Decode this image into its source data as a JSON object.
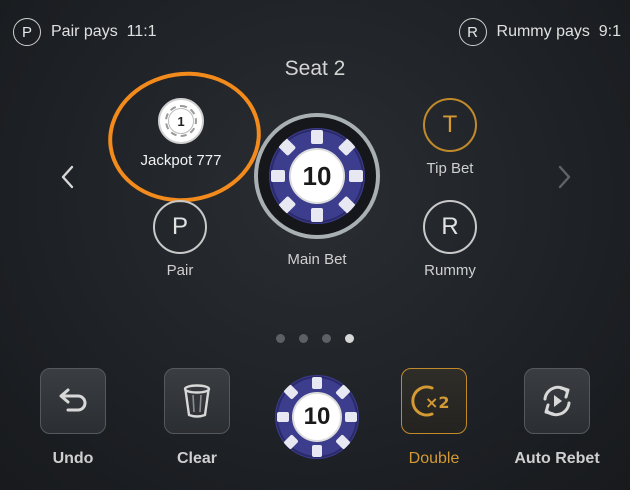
{
  "header": {
    "pair_badge": "P",
    "pair_pays": "Pair pays  11:1",
    "rummy_badge": "R",
    "rummy_pays": "Rummy pays  9:1"
  },
  "seat_title": "Seat 2",
  "bet_spots": {
    "jackpot": {
      "chip_value": "1",
      "label": "Jackpot 777"
    },
    "pair": {
      "badge": "P",
      "label": "Pair"
    },
    "main": {
      "chip_value": "10",
      "label": "Main Bet"
    },
    "tip": {
      "badge": "T",
      "label": "Tip Bet"
    },
    "rummy": {
      "badge": "R",
      "label": "Rummy"
    }
  },
  "pager": {
    "count": 4,
    "active_index": 3
  },
  "toolbar": {
    "undo": "Undo",
    "clear": "Clear",
    "selected_chip": "10",
    "double_icon": "×2",
    "double": "Double",
    "auto_rebet": "Auto Rebet"
  },
  "colors": {
    "accent_gold": "#d49a33",
    "highlight_orange": "#f28a1c",
    "chip_purple": "#3d3d8e"
  },
  "icons": {
    "prev": "chevron-left-icon",
    "next": "chevron-right-icon",
    "undo": "undo-arrow-icon",
    "clear": "trash-cup-icon",
    "double": "double-x2-icon",
    "rebet": "auto-rebet-cycle-icon"
  }
}
